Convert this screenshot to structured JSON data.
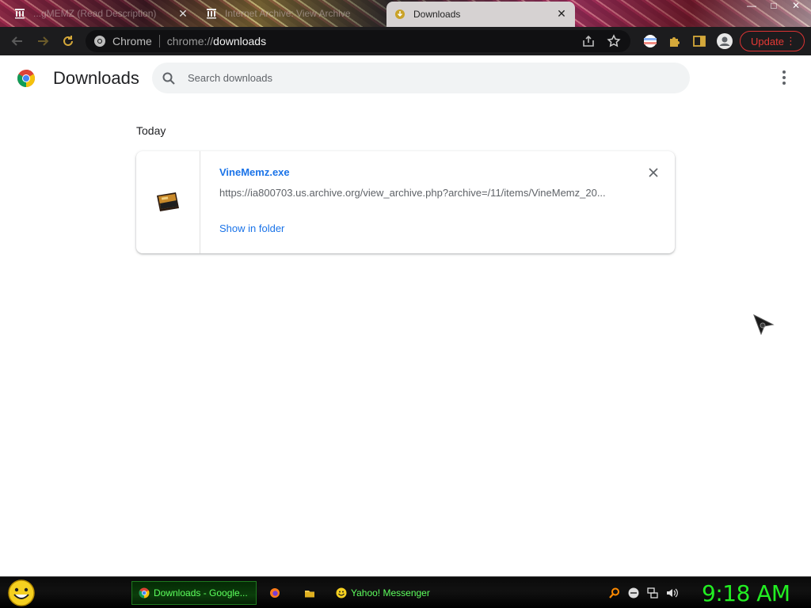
{
  "tabs": [
    {
      "title": "...gMEMZ (Read Description)",
      "state": "inactive",
      "icon": "archive-icon"
    },
    {
      "title": "Internet Archive: View Archive",
      "state": "inactive",
      "icon": "archive-icon"
    },
    {
      "title": "Downloads",
      "state": "active",
      "icon": "downloads-icon"
    }
  ],
  "window_controls": {
    "minimize": "—",
    "maximize": "□",
    "close": "✕"
  },
  "toolbar": {
    "chip_text": "Chrome",
    "url_scheme": "chrome://",
    "url_host": "downloads",
    "update_label": "Update"
  },
  "page": {
    "title": "Downloads",
    "search_placeholder": "Search downloads",
    "section_heading": "Today",
    "downloads": [
      {
        "file_name": "VineMemz.exe",
        "url": "https://ia800703.us.archive.org/view_archive.php?archive=/11/items/VineMemz_20...",
        "action_label": "Show in folder"
      }
    ]
  },
  "taskbar": {
    "tasks": [
      {
        "label": "Downloads - Google...",
        "icon": "chrome-icon",
        "active": true
      },
      {
        "label": "",
        "icon": "firefox-icon",
        "active": false
      },
      {
        "label": "",
        "icon": "folder-icon",
        "active": false
      },
      {
        "label": "Yahoo! Messenger",
        "icon": "yahoo-messenger-icon",
        "active": false
      }
    ],
    "clock": "9:18 AM"
  },
  "colors": {
    "accent_blue": "#1a73e8",
    "toolbar_bg": "#1c1c1e",
    "update_red": "#e53935",
    "taskbar_green": "#22ee22"
  }
}
